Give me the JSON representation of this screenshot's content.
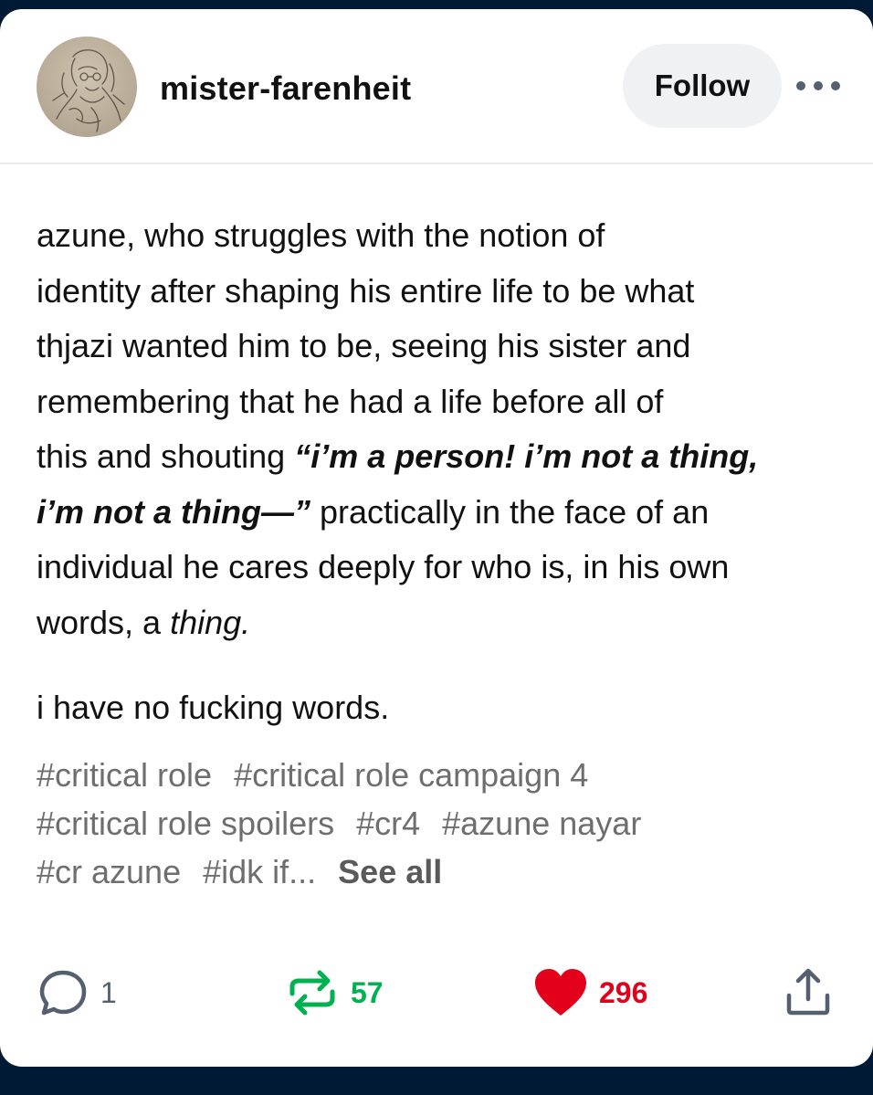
{
  "post": {
    "username": "mister-farenheit",
    "follow_label": "Follow",
    "more_label": "•••",
    "body": {
      "l1": "azune, who struggles with the notion of",
      "l2": "identity after shaping his entire life to be what",
      "l3": "thjazi wanted him to be, seeing his sister and",
      "l4": "remembering that he had a life before all of",
      "l5_pre": "this and shouting ",
      "l5_quote": "“i’m a person! i’m not a thing,",
      "l6_quote": "i’m not a thing—”",
      "l6_post": " practically in the face of an",
      "l7": "individual he cares deeply for who is, in his own",
      "l8_pre": "words, a ",
      "l8_it": "thing."
    },
    "para2": "i have no fucking words.",
    "tags": [
      "#critical role",
      "#critical role campaign 4",
      "#critical role spoilers",
      "#cr4",
      "#azune nayar",
      "#cr azune",
      "#idk if..."
    ],
    "see_all": "See all",
    "actions": {
      "replies": "1",
      "reblogs": "57",
      "likes": "296"
    },
    "colors": {
      "background": "#001935",
      "reblog": "#00b14f",
      "like": "#e2001a",
      "icon": "#54606f"
    },
    "icons": {
      "reply": "speech-bubble-icon",
      "reblog": "reblog-arrows-icon",
      "like": "heart-icon",
      "share": "share-upload-icon",
      "more": "more-dots-icon"
    }
  }
}
